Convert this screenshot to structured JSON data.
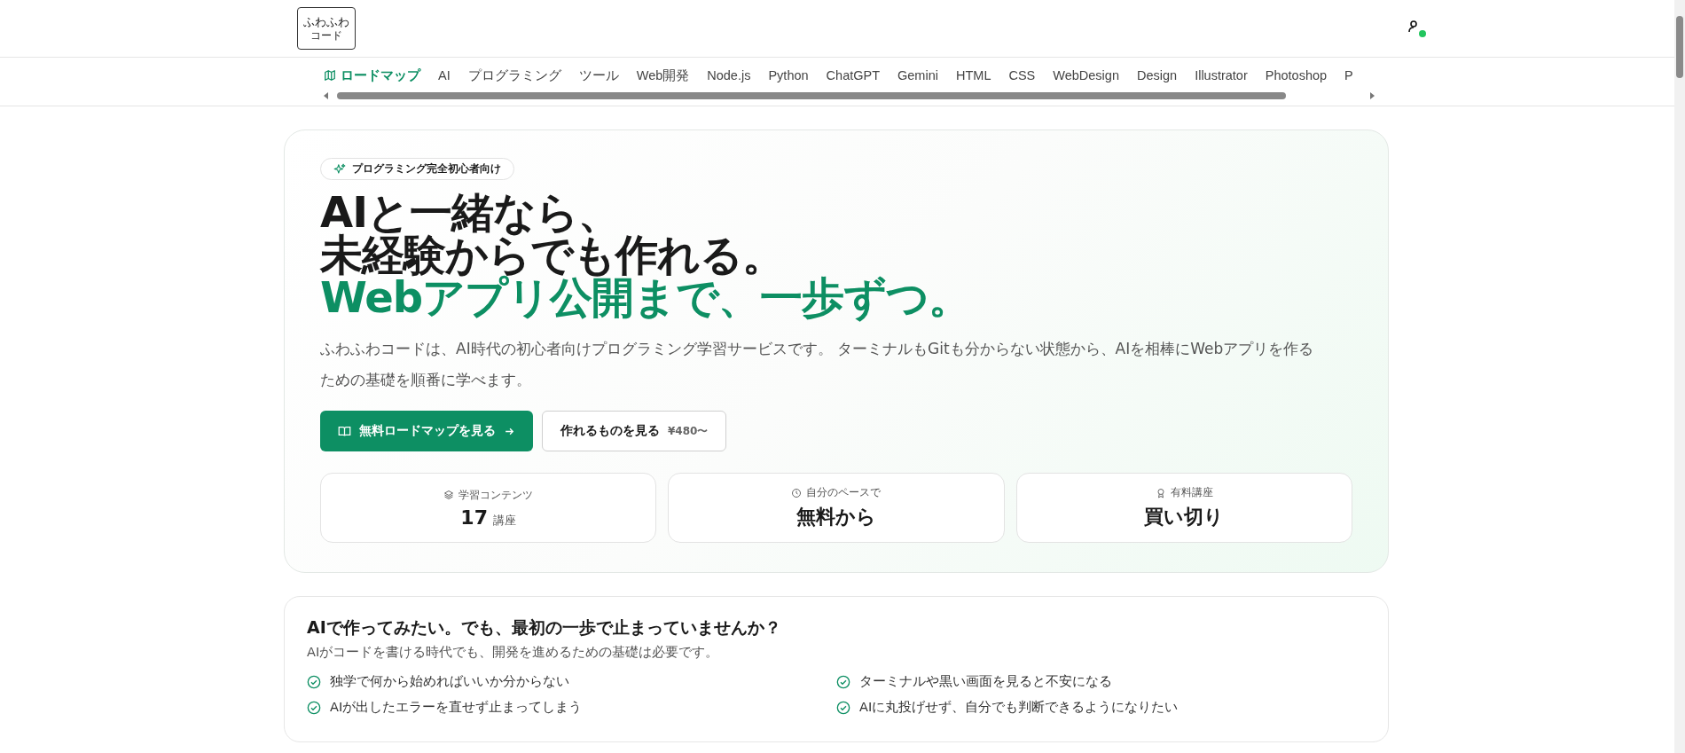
{
  "header": {
    "logo": [
      "ふわふわ",
      "コード"
    ],
    "account": {
      "online": true
    }
  },
  "nav": {
    "items": [
      {
        "label": "ロードマップ",
        "selected": true
      },
      {
        "label": "AI",
        "selected": false
      },
      {
        "label": "プログラミング",
        "selected": false
      },
      {
        "label": "ツール",
        "selected": false
      },
      {
        "label": "Web開発",
        "selected": false
      },
      {
        "label": "Node.js",
        "selected": false
      },
      {
        "label": "Python",
        "selected": false
      },
      {
        "label": "ChatGPT",
        "selected": false
      },
      {
        "label": "Gemini",
        "selected": false
      },
      {
        "label": "HTML",
        "selected": false
      },
      {
        "label": "CSS",
        "selected": false
      },
      {
        "label": "WebDesign",
        "selected": false
      },
      {
        "label": "Design",
        "selected": false
      },
      {
        "label": "Illustrator",
        "selected": false
      },
      {
        "label": "Photoshop",
        "selected": false
      },
      {
        "label": "P",
        "selected": false
      }
    ]
  },
  "hero": {
    "badge": "プログラミング完全初心者向け",
    "headline": [
      "AIと一緒なら、",
      "未経験からでも作れる。"
    ],
    "headline_accent": "Webアプリ公開まで、一歩ずつ。",
    "description": "ふわふわコードは、AI時代の初心者向けプログラミング学習サービスです。 ターミナルもGitも分からない状態から、AIを相棒にWebアプリを作るための基礎を順番に学べます。",
    "primary_button": "無料ロードマップを見る",
    "secondary_button": {
      "label": "作れるものを見る",
      "price": "¥480〜"
    },
    "stats": [
      {
        "kind": "layers",
        "label": "学習コンテンツ",
        "value": "17",
        "unit": "講座"
      },
      {
        "kind": "clock",
        "label": "自分のペースで",
        "value": "無料から"
      },
      {
        "kind": "award",
        "label": "有料講座",
        "value": "買い切り"
      }
    ]
  },
  "problems": {
    "title": "AIで作ってみたい。でも、最初の一歩で止まっていませんか？",
    "subtitle": "AIがコードを書ける時代でも、開発を進めるための基礎は必要です。",
    "items": [
      "独学で何から始めればいいか分からない",
      "ターミナルや黒い画面を見ると不安になる",
      "AIが出したエラーを直せず止まってしまう",
      "AIに丸投げせず、自分でも判断できるようになりたい"
    ]
  }
}
